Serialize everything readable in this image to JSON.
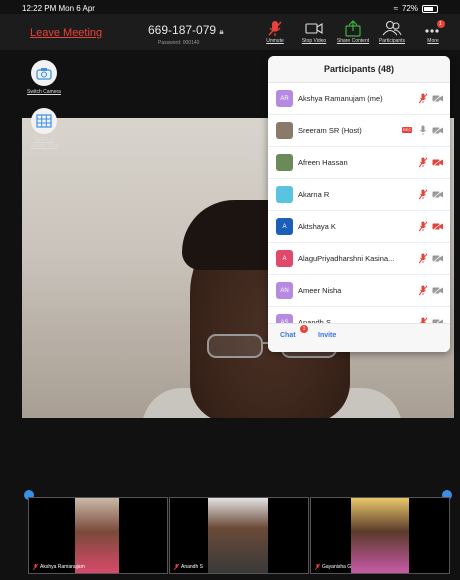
{
  "status_bar": {
    "time": "12:22 PM  Mon 6 Apr",
    "battery": "72%"
  },
  "toolbar": {
    "leave_label": "Leave Meeting",
    "meeting_id": "669-187-079",
    "password": "Password: 000140",
    "buttons": [
      {
        "label": "Unmute",
        "icon": "mic-muted-icon"
      },
      {
        "label": "Stop Video",
        "icon": "video-icon"
      },
      {
        "label": "Share Content",
        "icon": "share-icon"
      },
      {
        "label": "Participants",
        "icon": "participants-icon"
      },
      {
        "label": "More",
        "icon": "more-icon",
        "badge": "1"
      }
    ]
  },
  "side": {
    "switch_camera": "Switch Camera",
    "gallery_line1": "Switch to",
    "gallery_line2": "Gallery View"
  },
  "panel": {
    "title": "Participants (48)",
    "participants": [
      {
        "initials": "AR",
        "name": "Akshya Ramanujam (me)",
        "avatar_color": "#b48be0",
        "mic": "muted",
        "cam": "off-gray"
      },
      {
        "initials": "",
        "name": "Sreeram SR (Host)",
        "avatar_color": "#8a7a6a",
        "mic": "gray",
        "cam": "off-gray",
        "rec": "REC"
      },
      {
        "initials": "",
        "name": "Afreen Hassan",
        "avatar_color": "#6b8a5a",
        "mic": "muted",
        "cam": "off-red"
      },
      {
        "initials": "",
        "name": "Akarna R",
        "avatar_color": "#58c4e0",
        "mic": "muted",
        "cam": "off-gray"
      },
      {
        "initials": "A",
        "name": "Aktshaya K",
        "avatar_color": "#1d5fb8",
        "mic": "muted",
        "cam": "off-red"
      },
      {
        "initials": "A",
        "name": "AlaguPriyadharshni Kasina...",
        "avatar_color": "#e04a6a",
        "mic": "muted",
        "cam": "off-gray"
      },
      {
        "initials": "AN",
        "name": "Ameer Nisha",
        "avatar_color": "#b48be0",
        "mic": "muted",
        "cam": "off-gray"
      },
      {
        "initials": "AS",
        "name": "Anandh S",
        "avatar_color": "#b48be0",
        "mic": "muted",
        "cam": "off-gray"
      }
    ],
    "chat_label": "Chat",
    "chat_badge": "1",
    "invite_label": "Invite"
  },
  "thumbnails": [
    {
      "name": "Akshya Ramanujam"
    },
    {
      "name": "Anandh S"
    },
    {
      "name": "Gayanisha G"
    }
  ],
  "colors": {
    "accent": "#3a72e0",
    "danger": "#e8423a",
    "share_green": "#3cb043"
  }
}
